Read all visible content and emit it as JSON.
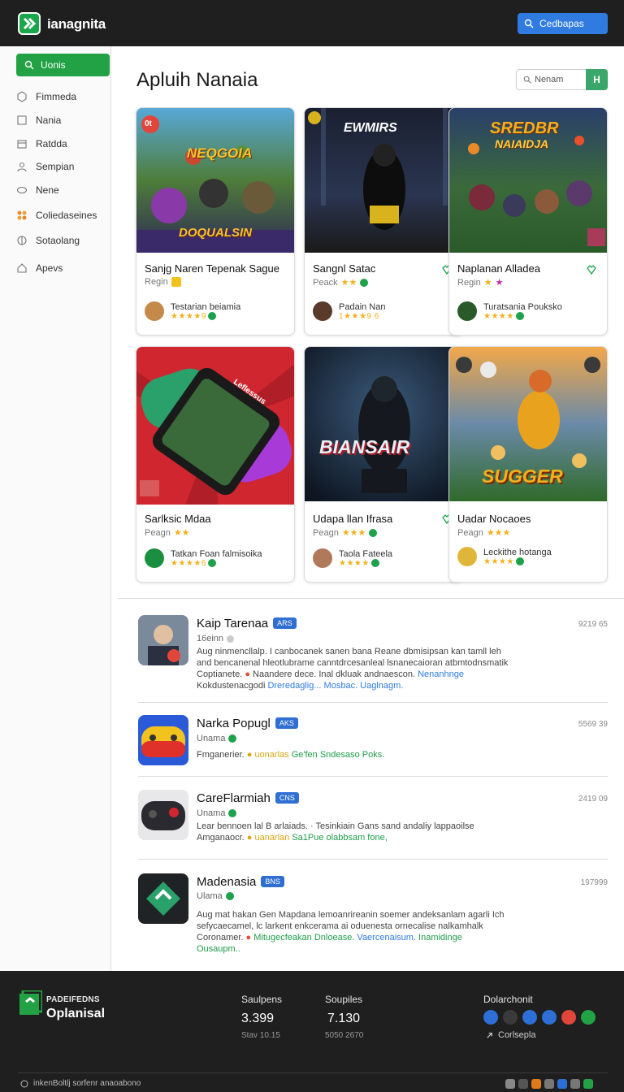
{
  "header": {
    "brand": "ianagnita",
    "button_label": "Cedbapas"
  },
  "sidebar": {
    "search_label": "Uonis",
    "items": [
      {
        "label": "Fimmeda",
        "icon": "grid-icon"
      },
      {
        "label": "Nania",
        "icon": "square-icon"
      },
      {
        "label": "Ratdda",
        "icon": "box-icon"
      },
      {
        "label": "Sempian",
        "icon": "users-icon"
      },
      {
        "label": "Nene",
        "icon": "chat-icon"
      },
      {
        "label": "Coliedaseines",
        "icon": "puzzle-icon"
      },
      {
        "label": "Sotaolang",
        "icon": "globe-icon"
      },
      {
        "label": "Apevs",
        "icon": "home-icon"
      }
    ]
  },
  "main": {
    "title": "Apluih Nanaia",
    "search_placeholder": "Nenam",
    "search_go_label": "H",
    "cards": [
      {
        "art_title": "NEQGOIA",
        "art_subtitle": "DOQUALSIN",
        "art_badge": "0t",
        "title": "Sanjg Naren Tepenak Sague",
        "sub": "Regin",
        "author": "Testarian beiamia",
        "rating": "★★★★9"
      },
      {
        "art_title": "EWMIRS",
        "title": "Sangnl Satac",
        "sub": "Peack",
        "author": "Padain Nan",
        "rating": "1★★★9 6"
      },
      {
        "art_title": "SREDBR",
        "art_subtitle": "NAIAIDJA",
        "title": "Naplanan Alladea",
        "sub": "Regin",
        "author": "Turatsania Pouksko",
        "rating": "★★★★"
      },
      {
        "art_title": "",
        "art_phone_text": "Leflessus",
        "title": "Sarlksic Mdaa",
        "sub": "Peagn",
        "author": "Tatkan Foan falmisoika",
        "rating": "★★★★6"
      },
      {
        "art_title": "BIANSAIR",
        "title": "Udapa llan Ifrasa",
        "sub": "Peagn",
        "author": "Taola Fateela",
        "rating": "★★★★"
      },
      {
        "art_title": "SUGGER",
        "title": "Uadar Nocaoes",
        "sub": "Peagn",
        "author": "Leckithe hotanga",
        "rating": "★★★★"
      }
    ]
  },
  "feed": [
    {
      "name": "Kaip Tarenaa",
      "tag": "ARS",
      "meta": "16einn",
      "count": "9219 65",
      "desc": [
        {
          "t": "Aug ninmencllalp. I canbocanek sanen bana Reane dbmisipsan kan tamll leh",
          "c": ""
        },
        {
          "t": "and bencanenal hleotlubrame canntdrcesanleal lsnanecaioran atbmtodnsmatik",
          "c": ""
        },
        {
          "t": "Coptianete. ",
          "c": "",
          "parts": [
            [
              "Coptianete. ",
              ""
            ],
            [
              "● ",
              "r"
            ],
            [
              "Naandere dece. Inal dkluak andnaescon. ",
              ""
            ],
            [
              "Nenanhnge",
              "b"
            ]
          ]
        },
        {
          "t": "Kokdustenacgodi ",
          "parts": [
            [
              "Kokdustenacgodi ",
              ""
            ],
            [
              "Dreredaglig...",
              "b"
            ],
            [
              "  Mosbac.  Uaglnagm.",
              "b"
            ]
          ]
        }
      ]
    },
    {
      "name": "Narka Popugl",
      "tag": "AKS",
      "meta": "Unama",
      "count": "5569 39",
      "desc": [
        {
          "parts": [
            [
              "Fmganerier. ",
              ""
            ],
            [
              "● uonarlas ",
              "y"
            ],
            [
              "Ge'fen Sndesaso Poks.",
              "g"
            ]
          ]
        }
      ]
    },
    {
      "name": "CareFlarmiah",
      "tag": "CNS",
      "meta": "Unama",
      "count": "2419 09",
      "desc": [
        {
          "parts": [
            [
              "Lear bennoen lal B arlaiads. · Tesinkiain Gans sand andaliy lappaoilse",
              ""
            ]
          ]
        },
        {
          "parts": [
            [
              "Amganaocr. ",
              ""
            ],
            [
              "● uanarlan ",
              "y"
            ],
            [
              "Sa1Pue olabbsam fone,",
              "g"
            ]
          ]
        }
      ]
    },
    {
      "name": "Madenasia",
      "tag": "BNS",
      "meta": "Ulama",
      "count": "197999",
      "desc": [
        {
          "parts": [
            [
              "Aug mat hakan Gen Mapdana lemoanrireanin soemer andeksanlam agarli Ich",
              ""
            ]
          ]
        },
        {
          "parts": [
            [
              "sefycaecamel, lc larkent enkcerama ai oduenesta ornecalise nalkamhalk",
              ""
            ]
          ]
        },
        {
          "parts": [
            [
              "Coronamer. ",
              ""
            ],
            [
              "● ",
              "r"
            ],
            [
              "Mitugecfeakan Dnloease. ",
              "g"
            ],
            [
              "Vaercenaisum. ",
              "b"
            ],
            [
              "Inamidinge",
              "g"
            ]
          ]
        },
        {
          "parts": [
            [
              "Ousaupm..",
              "g"
            ]
          ]
        }
      ]
    }
  ],
  "footer": {
    "brand_small": "PADEIFEDNS",
    "brand": "Oplanisal",
    "stats": [
      {
        "label": "Saulpens",
        "value": "3.399",
        "sub": "Stav 10.15"
      },
      {
        "label": "Soupiles",
        "value": "7.130",
        "sub": "5050 2670"
      }
    ],
    "social_title": "Dolarchonit",
    "social_colors": [
      "#2d6fd6",
      "#3a3a3a",
      "#2d6fd6",
      "#2d6fd6",
      "#e2463a",
      "#22a244"
    ],
    "link": "Corlsepla",
    "copyright": "inkenBoltlj sorfenr anaoabono",
    "mini_colors": [
      "#888",
      "#555",
      "#e07a1f",
      "#777",
      "#2d6fd6",
      "#777",
      "#22a244"
    ]
  },
  "colors": {
    "brand": "#22a244",
    "accent": "#2f7be0",
    "dark": "#1f1f1f"
  }
}
